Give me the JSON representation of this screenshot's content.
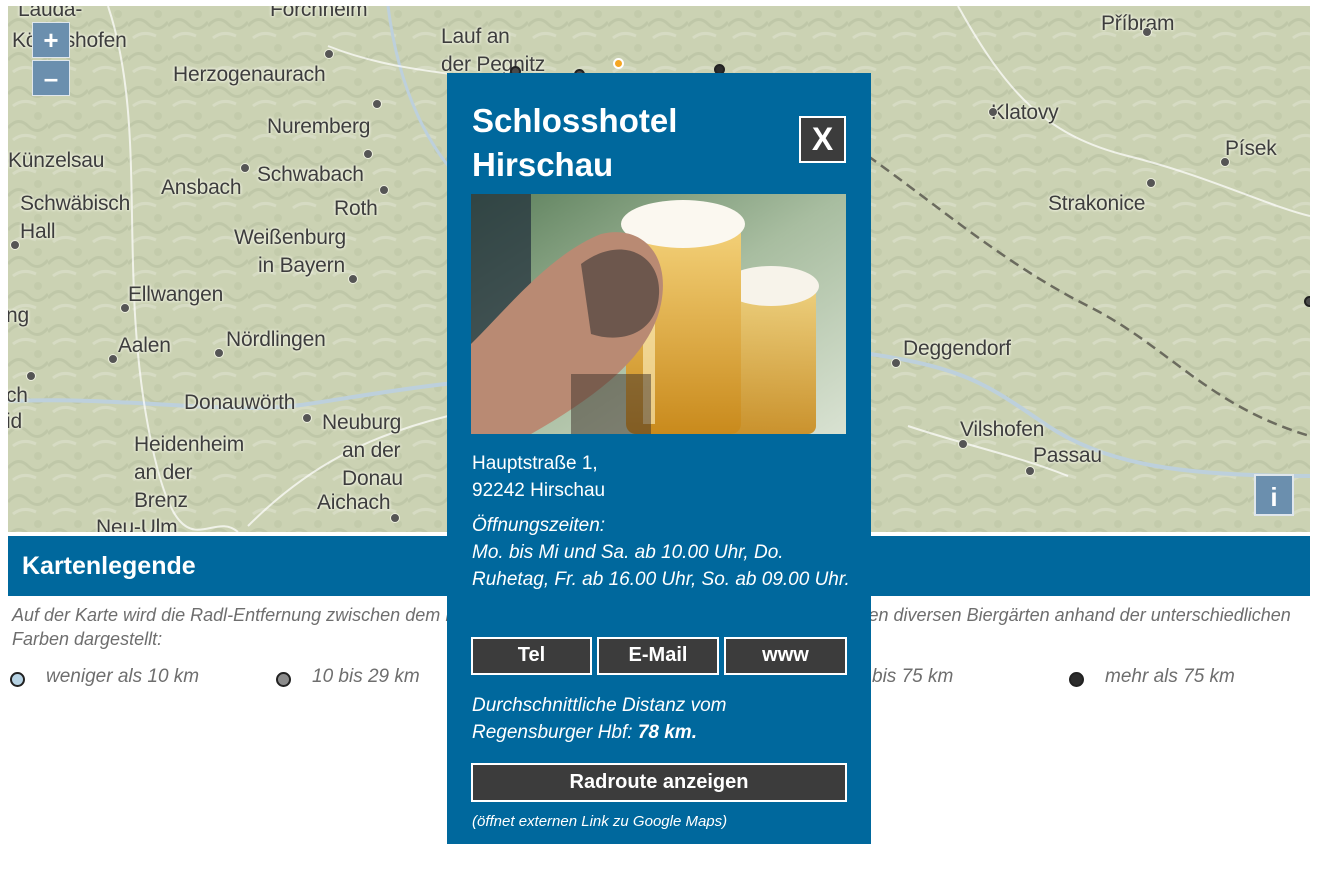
{
  "map": {
    "places": [
      {
        "name": "Lauda-"
      },
      {
        "name": "Königshofen"
      },
      {
        "name": "Forchheim"
      },
      {
        "name": "Lauf an"
      },
      {
        "name": "der Pegnitz"
      },
      {
        "name": "Příbram"
      },
      {
        "name": "Herzogenaurach"
      },
      {
        "name": "Nuremberg"
      },
      {
        "name": "Klatovy"
      },
      {
        "name": "Künzelsau"
      },
      {
        "name": "Schwabach"
      },
      {
        "name": "Písek"
      },
      {
        "name": "Ansbach"
      },
      {
        "name": "Schwäbisch"
      },
      {
        "name": "Hall"
      },
      {
        "name": "Roth"
      },
      {
        "name": "Strakonice"
      },
      {
        "name": "Weißenburg"
      },
      {
        "name": "in Bayern"
      },
      {
        "name": "Ellwangen"
      },
      {
        "name": "ng"
      },
      {
        "name": "Aalen"
      },
      {
        "name": "Nördlingen"
      },
      {
        "name": "Deggendorf"
      },
      {
        "name": "Donauwörth"
      },
      {
        "name": "Neuburg"
      },
      {
        "name": "an der"
      },
      {
        "name": "Donau"
      },
      {
        "name": "Heidenheim"
      },
      {
        "name": "an der"
      },
      {
        "name": "Brenz"
      },
      {
        "name": "Aichach"
      },
      {
        "name": "Vilshofen"
      },
      {
        "name": "Passau"
      },
      {
        "name": "Neu-Ulm"
      },
      {
        "name": "ch"
      },
      {
        "name": "id"
      }
    ],
    "zoom_in_label": "+",
    "zoom_out_label": "–",
    "info_label": "i"
  },
  "legend": {
    "title": "Kartenlegende",
    "text": "Auf der Karte wird die Radl-Entfernung zwischen dem Regensburger Hauptbahnhof (Ausgangspunkt) und den diversen Biergärten anhand der unterschiedlichen Farben dargestellt:",
    "items": [
      {
        "label": "weniger als 10 km",
        "color": "#b7d3e4"
      },
      {
        "label": "10 bis 29 km",
        "color": "#8c8c8c"
      },
      {
        "label": "bis 75 km",
        "color": "#5a5a5a"
      },
      {
        "label": "mehr als 75 km",
        "color": "#2c2c2c"
      }
    ]
  },
  "popup": {
    "title": "Schlosshotel Hirschau",
    "close_label": "X",
    "address_line1": "Hauptstraße 1,",
    "address_line2": "92242 Hirschau",
    "hours_heading": "Öffnungszeiten:",
    "hours_text": "Mo. bis Mi und Sa. ab 10.00 Uhr, Do. Ruhetag, Fr. ab 16.00 Uhr, So. ab 09.00 Uhr.",
    "buttons": [
      "Tel",
      "E-Mail",
      "www"
    ],
    "distance_prefix": "Durchschnittliche Distanz vom Regensburger Hbf: ",
    "distance_value": "78 km.",
    "route_label": "Radroute anzeigen",
    "route_note": "(öffnet externen Link zu Google Maps)"
  },
  "colors": {
    "accent": "#00689d",
    "button": "#3c3c3c",
    "highlight_dot": "#f5a623"
  }
}
